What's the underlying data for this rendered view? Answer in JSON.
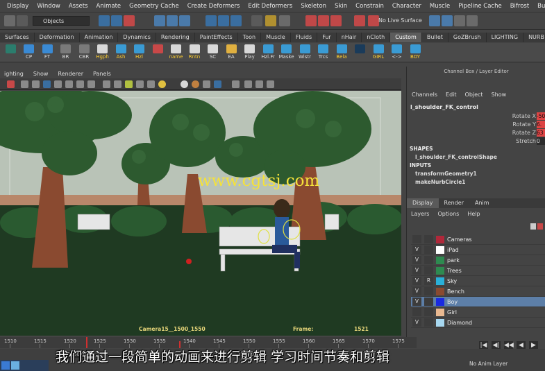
{
  "menubar": [
    "Display",
    "Window",
    "Assets",
    "Animate",
    "Geometry Cache",
    "Create Deformers",
    "Edit Deformers",
    "Skeleton",
    "Skin",
    "Constrain",
    "Character",
    "Muscle",
    "Pipeline Cache",
    "Bifrost",
    "Bullet",
    "Help"
  ],
  "status": {
    "objects_label": "Objects",
    "no_live": "No Live Surface"
  },
  "shelf_tabs": [
    "Surfaces",
    "Deformation",
    "Animation",
    "Dynamics",
    "Rendering",
    "PaintEffects",
    "Toon",
    "Muscle",
    "Fluids",
    "Fur",
    "nHair",
    "nCloth",
    "Custom",
    "Bullet",
    "GoZBrush",
    "LIGHTING",
    "NURB"
  ],
  "shelf_active": "Custom",
  "shelf_buttons": [
    {
      "label": "",
      "color": "#2b7d6d"
    },
    {
      "label": "CP",
      "color": "#3a8ad4"
    },
    {
      "label": "FT",
      "color": "#3a8ad4"
    },
    {
      "label": "BR",
      "color": "#7a7a7a"
    },
    {
      "label": "CBR",
      "color": "#7a7a7a"
    },
    {
      "label": "Hgph",
      "color": "#d8d8d8"
    },
    {
      "label": "Ash",
      "color": "#3a9bd4"
    },
    {
      "label": "Hzl",
      "color": "#3a9bd4"
    },
    {
      "label": "",
      "color": "#c84848"
    },
    {
      "label": "name",
      "color": "#d8d8d8"
    },
    {
      "label": "Rntn",
      "color": "#d8d8d8"
    },
    {
      "label": "SC",
      "color": "#d8d8d8"
    },
    {
      "label": "EA",
      "color": "#e0b040"
    },
    {
      "label": "Play",
      "color": "#d8d8d8"
    },
    {
      "label": "Hzl.Fr",
      "color": "#3a9bd4"
    },
    {
      "label": "Maske",
      "color": "#3a9bd4"
    },
    {
      "label": "Wistr",
      "color": "#3a9bd4"
    },
    {
      "label": "Trcs",
      "color": "#3a9bd4"
    },
    {
      "label": "Bela",
      "color": "#3a9bd4"
    },
    {
      "label": "",
      "color": "#1a3b5a"
    },
    {
      "label": "GIRL",
      "color": "#3a9bd4"
    },
    {
      "label": "<->",
      "color": "#3a9bd4"
    },
    {
      "label": "BOY",
      "color": "#3a9bd4"
    }
  ],
  "viewport_menu": [
    "ighting",
    "Show",
    "Renderer",
    "Panels"
  ],
  "hud": {
    "camera": "Camera15__1500_1550",
    "frame_label": "Frame:",
    "frame_value": "1521"
  },
  "watermark": "www.cgtsj.com",
  "right_panel": {
    "title": "Channel Box / Layer Editor",
    "menu": [
      "Channels",
      "Edit",
      "Object",
      "Show"
    ],
    "object": "l_shoulder_FK_control",
    "attrs": [
      {
        "name": "Rotate X",
        "value": "-50",
        "keyed": true
      },
      {
        "name": "Rotate Y",
        "value": "6.",
        "keyed": true
      },
      {
        "name": "Rotate Z",
        "value": "63",
        "keyed": true
      },
      {
        "name": "Stretch",
        "value": "0",
        "keyed": false
      }
    ],
    "shapes_header": "SHAPES",
    "shape_item": "l_shoulder_FK_controlShape",
    "inputs_header": "INPUTS",
    "inputs": [
      "transformGeometry1",
      "makeNurbCircle1"
    ],
    "display_tabs": [
      "Display",
      "Render",
      "Anim"
    ],
    "layer_menu": [
      "Layers",
      "Options",
      "Help"
    ],
    "layers": [
      {
        "v": "",
        "p": "",
        "color": "#b0283a",
        "name": "Cameras",
        "selected": false
      },
      {
        "v": "V",
        "p": "",
        "color": "#ffffff",
        "name": "iPad",
        "selected": false
      },
      {
        "v": "V",
        "p": "",
        "color": "#2e8a50",
        "name": "park",
        "selected": false
      },
      {
        "v": "V",
        "p": "",
        "color": "#2e8a50",
        "name": "Trees",
        "selected": false
      },
      {
        "v": "V",
        "p": "R",
        "color": "#2ab0d8",
        "name": "Sky",
        "selected": false
      },
      {
        "v": "V",
        "p": "",
        "color": "#8a4a30",
        "name": "Bench",
        "selected": false
      },
      {
        "v": "V",
        "p": "",
        "color": "#1a2ae0",
        "name": "Boy",
        "selected": true
      },
      {
        "v": "",
        "p": "",
        "color": "#e8b890",
        "name": "Girl",
        "selected": false
      },
      {
        "v": "V",
        "p": "",
        "color": "#a8d8f0",
        "name": "Diamond",
        "selected": false
      }
    ]
  },
  "timeline": {
    "ticks": [
      "1510",
      "1515",
      "1520",
      "1525",
      "1530",
      "1535",
      "1540",
      "1545",
      "1550",
      "1555",
      "1560",
      "1565",
      "1570",
      "1575"
    ],
    "range_start": "1500.00",
    "range_end": "1550.00"
  },
  "playback": [
    "|◀",
    "◀|",
    "◀◀",
    "◀",
    "▶"
  ],
  "anim_layer": "No Anim Layer",
  "subtitle": "我们通过一段简单的动画来进行剪辑 学习时间节奏和剪辑"
}
